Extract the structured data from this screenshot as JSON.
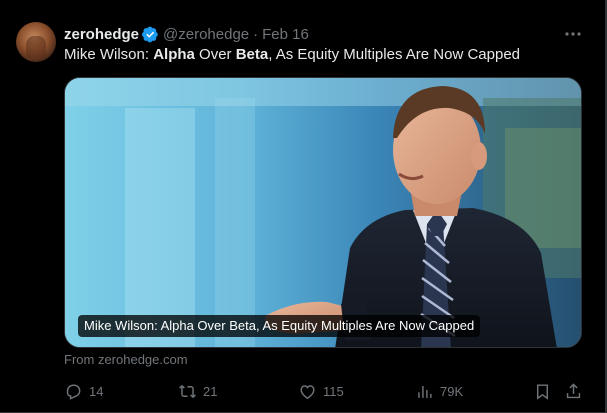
{
  "tweet": {
    "author_name": "zerohedge",
    "author_handle": "@zerohedge",
    "separator": "·",
    "date": "Feb 16",
    "text_parts": [
      "Mike Wilson: ",
      "Alpha",
      " Over ",
      "Beta",
      ", As Equity Multiples Are Now Capped"
    ],
    "card_caption": "Mike Wilson: Alpha Over Beta, As Equity Multiples Are Now Capped",
    "source": "From zerohedge.com"
  },
  "actions": {
    "replies": "14",
    "reposts": "21",
    "likes": "115",
    "views": "79K"
  },
  "icons": {
    "verified": "verified-badge-icon",
    "more": "more-icon",
    "reply": "reply-icon",
    "repost": "repost-icon",
    "like": "heart-icon",
    "views": "views-icon",
    "bookmark": "bookmark-icon",
    "share": "share-icon"
  },
  "colors": {
    "background": "#000000",
    "text_primary": "#e7e9ea",
    "text_secondary": "#71767b",
    "verified": "#1d9bf0"
  }
}
